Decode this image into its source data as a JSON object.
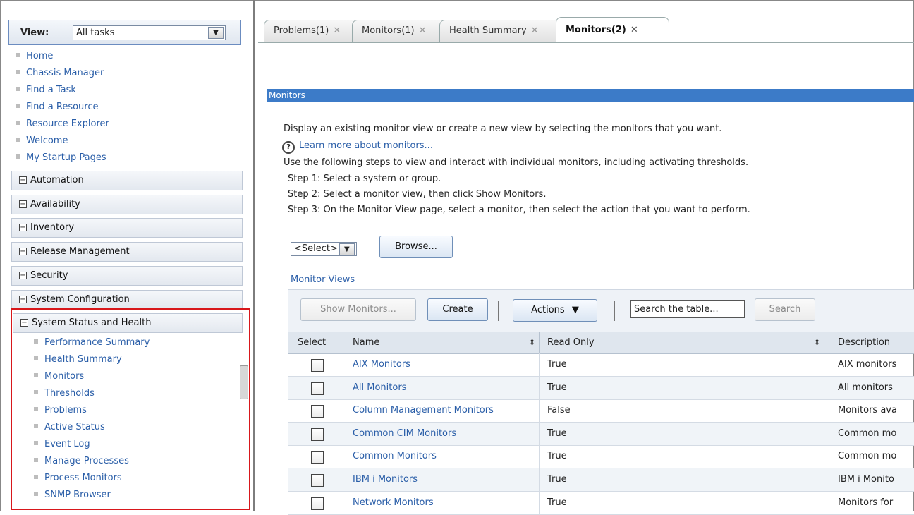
{
  "nav": {
    "view_label": "View:",
    "view_value": "All tasks",
    "quick_links": [
      "Home",
      "Chassis Manager",
      "Find a Task",
      "Find a Resource",
      "Resource Explorer",
      "Welcome",
      "My Startup Pages"
    ],
    "groups": [
      "Automation",
      "Availability",
      "Inventory",
      "Release Management",
      "Security",
      "System Configuration"
    ],
    "expanded_group": "System Status and Health",
    "expanded_items": [
      "Performance Summary",
      "Health Summary",
      "Monitors",
      "Thresholds",
      "Problems",
      "Active Status",
      "Event Log",
      "Manage Processes",
      "Process Monitors",
      "SNMP Browser"
    ],
    "expand_glyph": "+",
    "collapse_glyph": "−"
  },
  "tabs": [
    {
      "label": "Problems(1)",
      "active": false
    },
    {
      "label": "Monitors(1)",
      "active": false
    },
    {
      "label": "Health Summary",
      "active": false
    },
    {
      "label": "Monitors(2)",
      "active": true
    }
  ],
  "tab_close_glyph": "✕",
  "panel": {
    "title": "Monitors",
    "intro": "Display an existing monitor view or create a new view by selecting the monitors that you want.",
    "learn_more": "Learn more about monitors...",
    "instructions": "Use the following steps to view and interact with individual monitors, including activating thresholds.",
    "step1": "Step 1: Select a system or group.",
    "step2": "Step 2: Select a monitor view, then click Show Monitors.",
    "step3": "Step 3: On the Monitor View page, select a monitor, then select the action that you want to perform.",
    "system_select": "<Select>",
    "browse": "Browse..."
  },
  "monitor_views": {
    "title": "Monitor Views",
    "toolbar": {
      "show_monitors": "Show Monitors...",
      "create": "Create",
      "actions": "Actions",
      "search_placeholder": "Search the table...",
      "search": "Search"
    },
    "columns": [
      "Select",
      "Name",
      "Read Only",
      "Description"
    ],
    "rows": [
      {
        "name": "AIX Monitors",
        "read_only": "True",
        "description": "AIX monitors"
      },
      {
        "name": "All Monitors",
        "read_only": "True",
        "description": "All monitors"
      },
      {
        "name": "Column Management Monitors",
        "read_only": "False",
        "description": "Monitors ava"
      },
      {
        "name": "Common CIM Monitors",
        "read_only": "True",
        "description": "Common mo"
      },
      {
        "name": "Common Monitors",
        "read_only": "True",
        "description": "Common mo"
      },
      {
        "name": "IBM i Monitors",
        "read_only": "True",
        "description": "IBM i Monito"
      },
      {
        "name": "Network Monitors",
        "read_only": "True",
        "description": "Monitors for"
      }
    ]
  },
  "colors": {
    "accent": "#3c7bc8",
    "link": "#2a5ea8",
    "highlight_border": "#d8171b"
  }
}
